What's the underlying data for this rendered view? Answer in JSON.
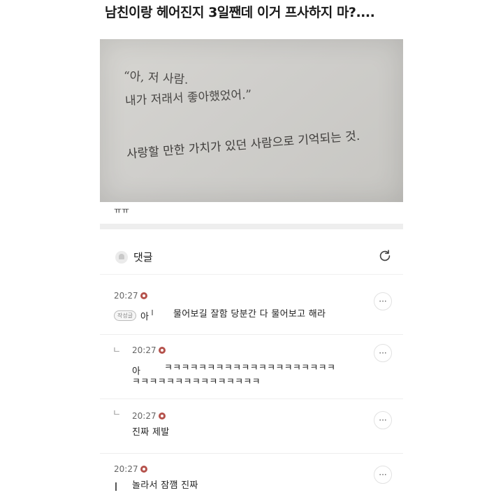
{
  "post": {
    "title": "남친이랑 헤어진지 3일짼데 이거 프사하지 마?....",
    "photo_lines": [
      "“아, 저 사람.",
      "내가 저래서 좋아했었어.”",
      "사랑할 만한 가치가 있던 사람으로 기억되는 것."
    ],
    "body_text": "ㅠㅠ"
  },
  "comments_section": {
    "label": "댓글",
    "icons": {
      "header": "bell-icon",
      "refresh": "refresh-icon",
      "more": "more-icon"
    },
    "accent_color": "#b5524c",
    "more_label": "···",
    "comments": [
      {
        "time": "20:27",
        "is_reply": false,
        "author_badge": "작성글",
        "prefix": "아",
        "text": "물어보길 잘함 당분간 다 물어보고 해라"
      },
      {
        "time": "20:27",
        "is_reply": true,
        "reply_mark": "ㄴ",
        "prefix": "아",
        "text_line1": "ㅋㅋㅋㅋㅋㅋㅋㅋㅋㅋㅋㅋㅋㅋㅋㅋㅋㅋㅋㅋ",
        "text_line2": "ㅋㅋㅋㅋㅋㅋㅋㅋㅋㅋㅋㅋㅋㅋㅋ"
      },
      {
        "time": "20:27",
        "is_reply": true,
        "reply_mark": "ㄴ",
        "text": "진짜 제발"
      },
      {
        "time": "20:27",
        "is_reply": false,
        "text": "놀라서 잠깸 진짜"
      }
    ]
  }
}
